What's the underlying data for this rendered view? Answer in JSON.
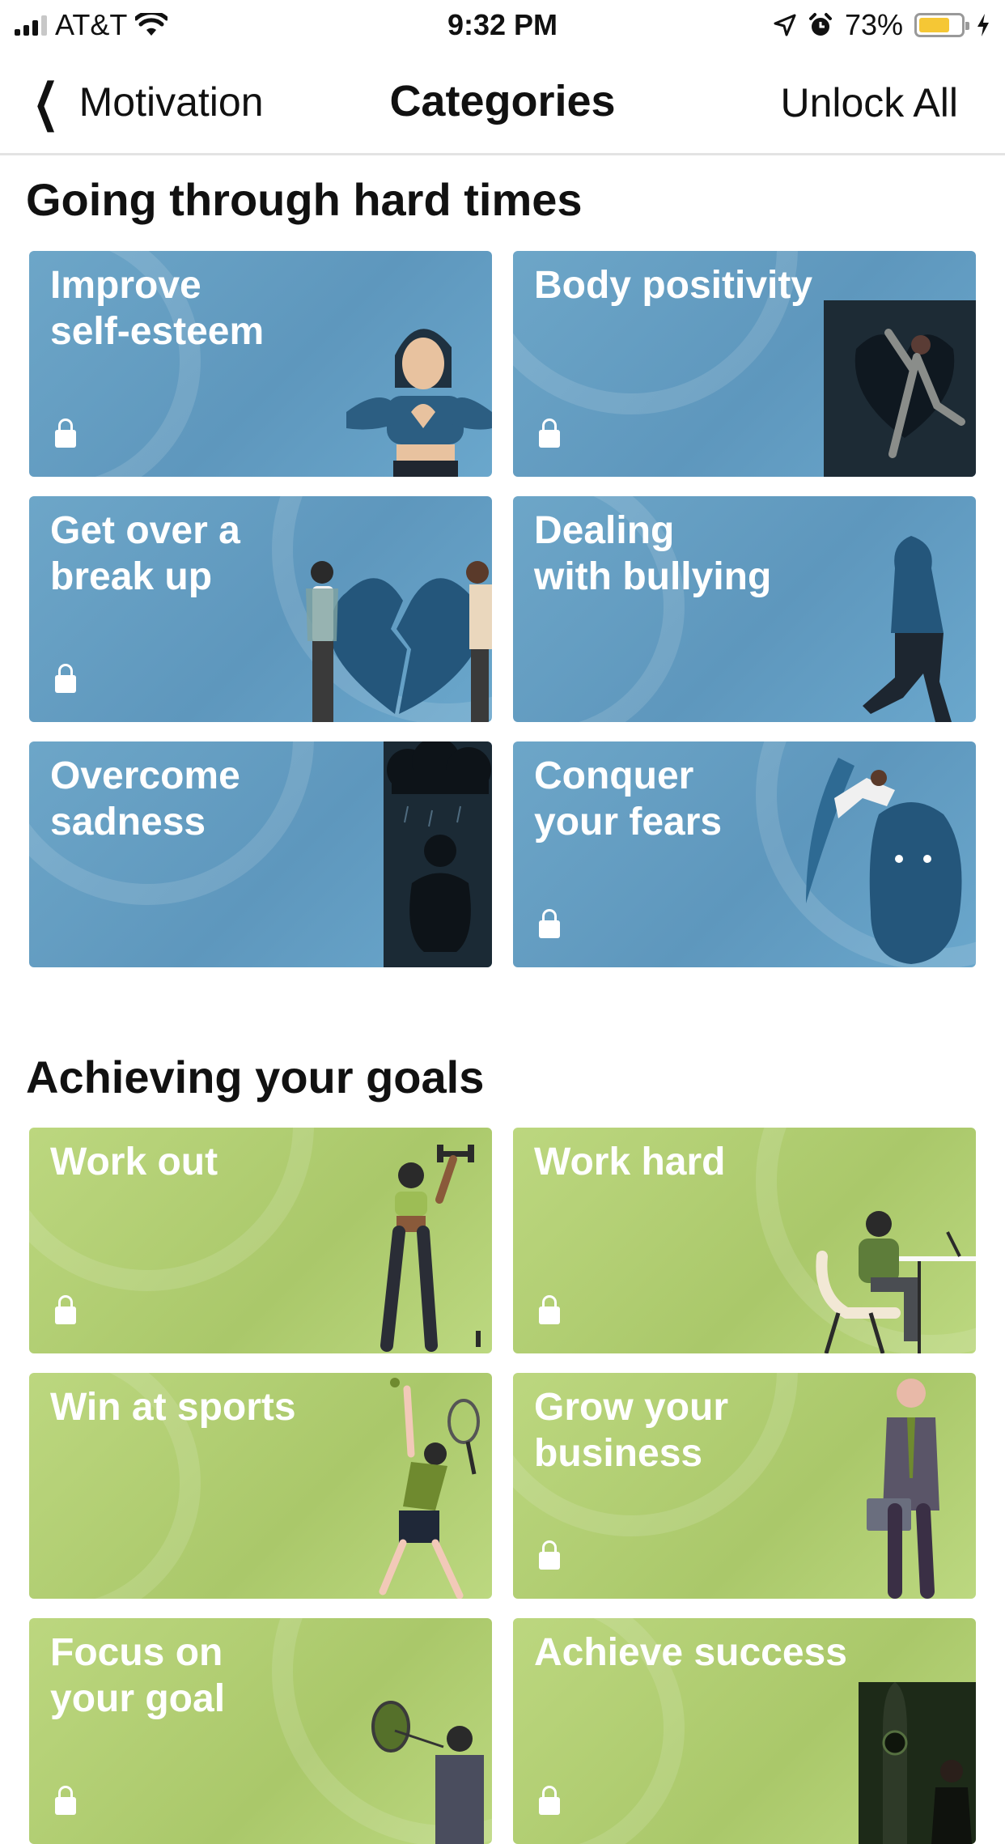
{
  "status_bar": {
    "carrier": "AT&T",
    "time": "9:32 PM",
    "battery": "73%",
    "battery_level": 0.73
  },
  "nav": {
    "back_label": "Motivation",
    "title": "Categories",
    "action_label": "Unlock All"
  },
  "sections": [
    {
      "title": "Going through hard times",
      "theme": "blue",
      "cards": [
        {
          "label": "Improve\nself-esteem",
          "locked": true,
          "icon": "heart-hands-illustration"
        },
        {
          "label": "Body positivity",
          "locked": true,
          "icon": "dancer-heart-illustration"
        },
        {
          "label": "Get over a\nbreak up",
          "locked": true,
          "icon": "broken-heart-illustration"
        },
        {
          "label": "Dealing\nwith bullying",
          "locked": false,
          "icon": "hooded-walker-illustration"
        },
        {
          "label": "Overcome\nsadness",
          "locked": false,
          "icon": "rain-cloud-illustration"
        },
        {
          "label": "Conquer\nyour fears",
          "locked": true,
          "icon": "monster-illustration"
        }
      ]
    },
    {
      "title": "Achieving your goals",
      "theme": "green",
      "cards": [
        {
          "label": "Work out",
          "locked": true,
          "icon": "dumbbell-woman-illustration"
        },
        {
          "label": "Work hard",
          "locked": true,
          "icon": "desk-worker-illustration"
        },
        {
          "label": "Win at sports",
          "locked": false,
          "icon": "tennis-player-illustration"
        },
        {
          "label": "Grow your\nbusiness",
          "locked": true,
          "icon": "businessman-illustration"
        },
        {
          "label": "Focus on\nyour goal",
          "locked": true,
          "icon": "dart-target-illustration"
        },
        {
          "label": "Achieve success",
          "locked": true,
          "icon": "rocket-illustration"
        }
      ]
    }
  ],
  "colors": {
    "blue_card": "#6aa3c6",
    "green_card": "#b5d177",
    "text": "#111111",
    "card_text": "#ffffff"
  }
}
